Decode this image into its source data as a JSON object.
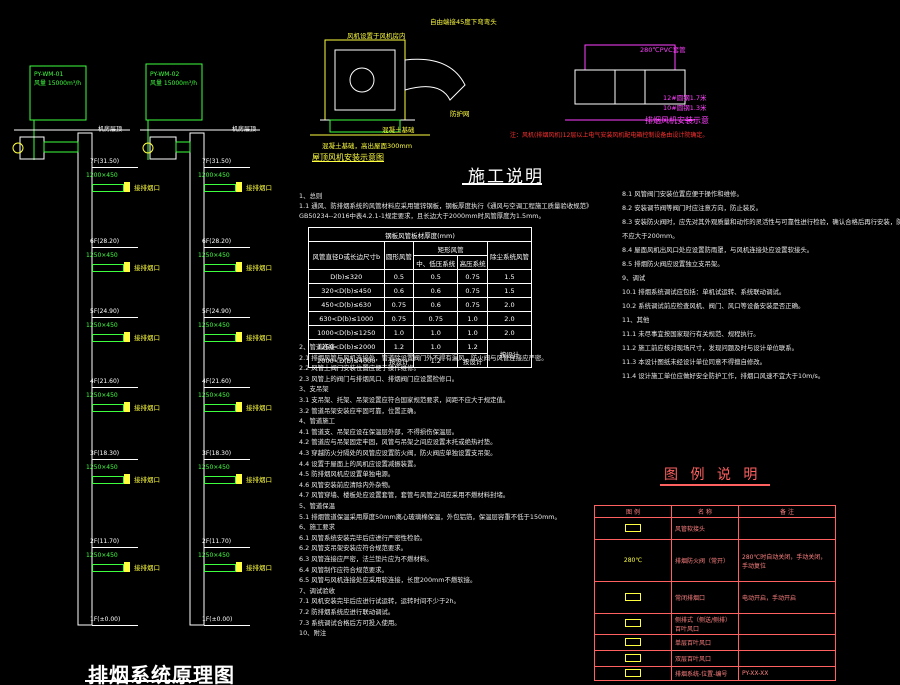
{
  "titles": {
    "schematic": "排烟系统原理图",
    "construction_notes": "施工说明",
    "legend": "图 例 说 明",
    "roof_fan": "屋顶风机安装示意图",
    "valve_install": "排烟风机安装示意"
  },
  "spec_table": {
    "caption": "钢板风管板材厚度(mm)",
    "headers": [
      "风管直径D或长边尺寸b",
      "圆形风管",
      "中、低压系统",
      "高压系统",
      "除尘系统风管"
    ],
    "header_group": "矩形风管",
    "rows": [
      [
        "D(b)≤320",
        "0.5",
        "0.5",
        "0.75",
        "1.5"
      ],
      [
        "320<D(b)≤450",
        "0.6",
        "0.6",
        "0.75",
        "1.5"
      ],
      [
        "450<D(b)≤630",
        "0.75",
        "0.6",
        "0.75",
        "2.0"
      ],
      [
        "630<D(b)≤1000",
        "0.75",
        "0.75",
        "1.0",
        "2.0"
      ],
      [
        "1000<D(b)≤1250",
        "1.0",
        "1.0",
        "1.0",
        "2.0"
      ],
      [
        "1250<D(b)≤2000",
        "1.2",
        "1.0",
        "1.2",
        "按设计"
      ],
      [
        "2000<D(b)≤4000",
        "按设计",
        "1.2",
        "按设计",
        ""
      ]
    ]
  },
  "notes_left": [
    "1、总则",
    "1.1 通风、防排烟系统的风管材料应采用镀锌钢板，钢板厚度执行《通风与空调工程施工质量验收规范》",
    "GB50234--2016中表4.2.1-1规定要求，且长边大于2000mm时风管厚度为1.5mm。",
    "2、管道连接",
    "2.1 排烟风管与风机连接处，管道除设置阀门外不得有漏风，防火阀与风管连接应严密。",
    "2.2 风管上阀门安装位置应便于操作维修。",
    "2.3 风管上的阀门与排烟风口、排烟阀门应设置检修口。",
    "3、支吊架",
    "3.1 支吊架、托架、吊架设置应符合国家规范要求，间距不应大于规定值。",
    "3.2 管道吊架安装应牢固可靠，位置正确。",
    "4、管道施工",
    "4.1 管道支、吊架应设在保温层外部，不得损伤保温层。",
    "4.2 管道应与吊架固定牢固，风管与吊架之间应设置木托或绝热衬垫。",
    "4.3 穿越防火分隔处的风管应设置防火阀，防火阀应单独设置支吊架。",
    "4.4 设置于屋面上的风机应设置减振装置。",
    "4.5 防排烟风机应设置单独电源。",
    "4.6 风管安装前应清除内外杂物。",
    "4.7 风管穿墙、楼板处应设置套管，套管与风管之间应采用不燃材料封堵。",
    "5、管道保温",
    "5.1 排烟管道保温采用厚度50mm离心玻璃棉保温，外包铝箔，保温层容重不低于150mm。",
    "6、施工要求",
    "6.1 风管系统安装完毕后应进行严密性检验。",
    "6.2 风管支吊架安装应符合规范要求。",
    "6.3 风管连接应严密，法兰垫片应为不燃材料。",
    "6.4 风管制作应符合规范要求。",
    "6.5 风管与风机连接处应采用软连接，长度200mm不燃软接。",
    "7、调试验收",
    "7.1 风机安装完毕后应进行试运转，运转时间不少于2h。",
    "7.2 防排烟系统应进行联动调试。",
    "7.3 系统调试合格后方可投入使用。",
    "10、附注"
  ],
  "notes_right": [
    "8.1 风管阀门安装位置应便于操作和维修。",
    "8.2 安装调节阀等阀门时应注意方向，防止装反。",
    "8.3 安装防火阀时，应先对其外观质量和动作的灵活性与可靠性进行检验，确认合格后再行安装，防火阀距墙表面",
    "    不应大于200mm。",
    "8.4 屋面风机出风口处应设置防雨罩，与风机连接处应设置软接头。",
    "8.5 排烟防火阀应设置独立支吊架。",
    "9、调试",
    "10.1 排烟系统调试应包括：单机试运转、系统联动调试。",
    "10.2 系统调试前应检查风机、阀门、风口等设备安装是否正确。",
    "11、其他",
    "11.1 未尽事宜按国家现行有关规范、规程执行。",
    "11.2 施工前应核对现场尺寸，发现问题及时与设计单位联系。",
    "11.3 本设计图纸未经设计单位同意不得擅自修改。",
    "11.4 设计施工单位应做好安全防护工作，排烟口风速不宜大于10m/s。"
  ],
  "legend_table": {
    "headers": [
      "图 例",
      "名 称",
      "备 注"
    ],
    "rows": [
      [
        "",
        "风管软接头",
        ""
      ],
      [
        "280℃",
        "排烟防火阀（常开）",
        "280℃时自动关闭，手动关闭，手动复位"
      ],
      [
        "",
        "常闭排烟口",
        "电动开启，手动开启"
      ],
      [
        "",
        "侧排式（侧送/侧排）百叶风口",
        ""
      ],
      [
        "",
        "单层百叶风口",
        ""
      ],
      [
        "",
        "双层百叶风口",
        ""
      ],
      [
        "",
        "排烟系统-位置-编号",
        "PY-XX-XX"
      ]
    ]
  },
  "schematic_labels": {
    "fan_left": "屋顶排烟风机",
    "fan_right": "屋顶排烟风机",
    "tags_left": [
      "PY-WM-01",
      "风量 15000m³/h"
    ],
    "tags_right": [
      "PY-WM-02",
      "风量 15000m³/h"
    ],
    "roof": "机房层顶",
    "duct_sizes": [
      "1200×450",
      "1250×450",
      "1250×450",
      "1250×450",
      "1250×450",
      "1250×450"
    ],
    "exit_label": "接排烟口",
    "floors_left": [
      "7F(31.50)",
      "6F(28.20)",
      "5F(24.90)",
      "4F(21.60)",
      "3F(18.30)",
      "2F(11.70)",
      "1F(±0.00)"
    ],
    "floors_right": [
      "7F(31.50)",
      "6F(28.20)",
      "5F(24.90)",
      "4F(21.60)",
      "3F(18.30)",
      "2F(11.70)",
      "1F(±0.00)"
    ]
  },
  "detail_labels": {
    "fan_top": "风机设置于风机房内",
    "elbow": "自由端接45度下弯弯头",
    "guard": "防护网",
    "base": "混凝土基础",
    "note_base": "混凝土基础，高出屋面300mm",
    "valve_top": "280℃PVC套管",
    "valve_l1": "12#圆钢1.7米",
    "valve_l2": "10#圆钢1.3米",
    "valve_note": "注：风机(排烟风机)12层以上电气安装风机配电箱控制设备由设计院确定。"
  }
}
